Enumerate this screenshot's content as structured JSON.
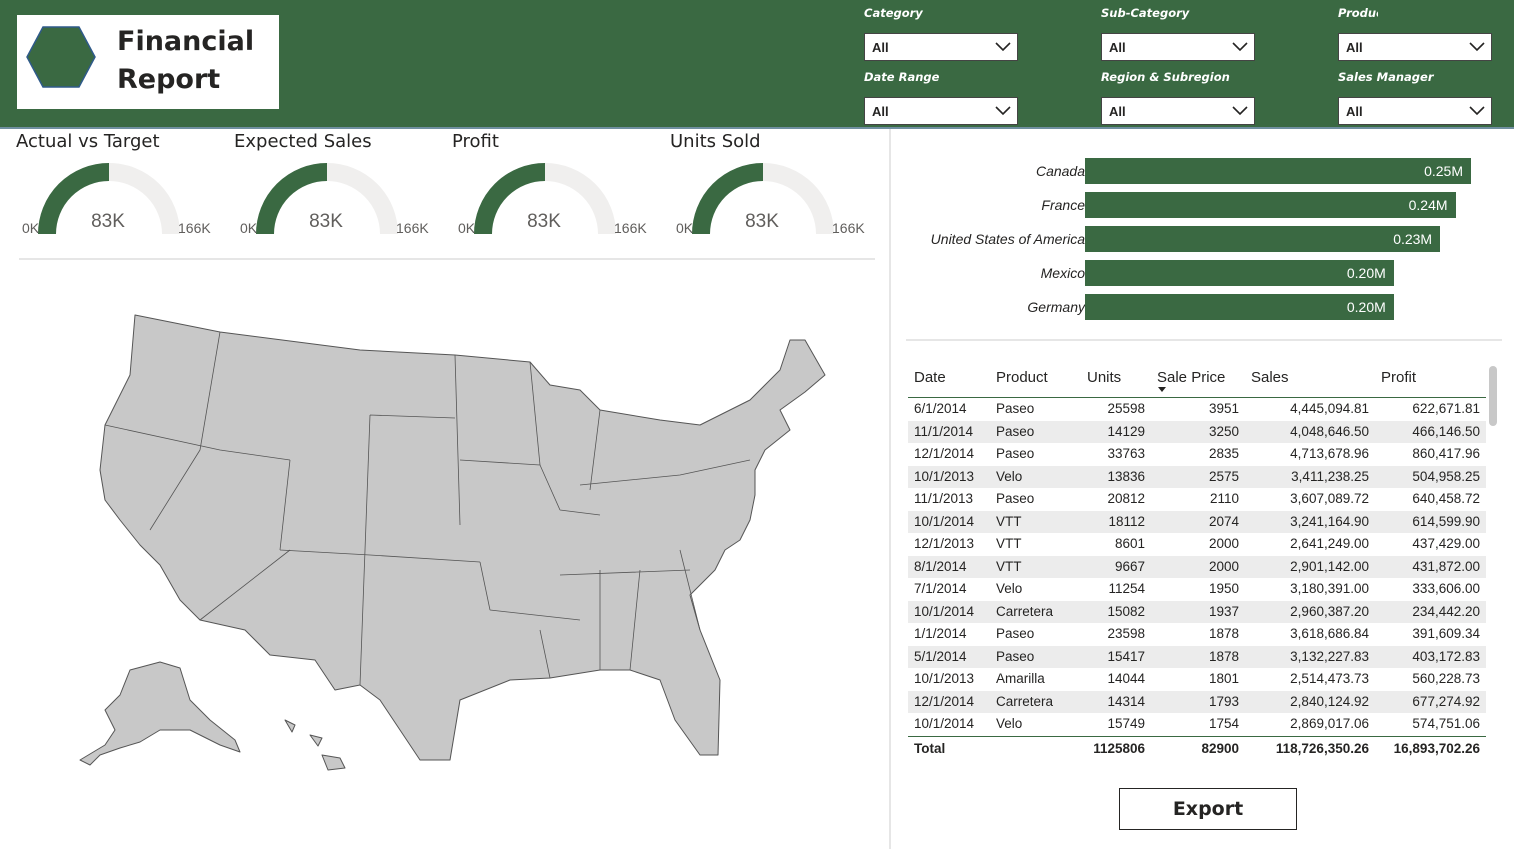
{
  "header": {
    "title": "Financial Report",
    "logo_icon": "hexagon-icon"
  },
  "slicers": [
    {
      "label": "Category",
      "value": "All"
    },
    {
      "label": "Sub-Category",
      "value": "All"
    },
    {
      "label": "Product",
      "value": "All"
    },
    {
      "label": "Date Range",
      "value": "All"
    },
    {
      "label": "Region & Subregion",
      "value": "All"
    },
    {
      "label": "Sales Manager",
      "value": "All"
    }
  ],
  "gauges": [
    {
      "title": "Actual vs Target",
      "min": "0K",
      "value_label": "83K",
      "max": "166K",
      "value": 83,
      "max_value": 166
    },
    {
      "title": "Expected Sales",
      "min": "0K",
      "value_label": "83K",
      "max": "166K",
      "value": 83,
      "max_value": 166
    },
    {
      "title": "Profit",
      "min": "0K",
      "value_label": "83K",
      "max": "166K",
      "value": 83,
      "max_value": 166
    },
    {
      "title": "Units Sold",
      "min": "0K",
      "value_label": "83K",
      "max": "166K",
      "value": 83,
      "max_value": 166
    }
  ],
  "chart_data": {
    "type": "bar",
    "orientation": "horizontal",
    "categories": [
      "Canada",
      "France",
      "United States of America",
      "Mexico",
      "Germany"
    ],
    "values": [
      0.25,
      0.24,
      0.23,
      0.2,
      0.2
    ],
    "value_labels": [
      "0.25M",
      "0.24M",
      "0.23M",
      "0.20M",
      "0.20M"
    ],
    "unit": "M"
  },
  "table": {
    "columns": [
      "Date",
      "Product",
      "Units",
      "Sale Price",
      "Sales",
      "Profit"
    ],
    "rows": [
      [
        "6/1/2014",
        "Paseo",
        "25598",
        "3951",
        "4,445,094.81",
        "622,671.81"
      ],
      [
        "11/1/2014",
        "Paseo",
        "14129",
        "3250",
        "4,048,646.50",
        "466,146.50"
      ],
      [
        "12/1/2014",
        "Paseo",
        "33763",
        "2835",
        "4,713,678.96",
        "860,417.96"
      ],
      [
        "10/1/2013",
        "Velo",
        "13836",
        "2575",
        "3,411,238.25",
        "504,958.25"
      ],
      [
        "11/1/2013",
        "Paseo",
        "20812",
        "2110",
        "3,607,089.72",
        "640,458.72"
      ],
      [
        "10/1/2014",
        "VTT",
        "18112",
        "2074",
        "3,241,164.90",
        "614,599.90"
      ],
      [
        "12/1/2013",
        "VTT",
        "8601",
        "2000",
        "2,641,249.00",
        "437,429.00"
      ],
      [
        "8/1/2014",
        "VTT",
        "9667",
        "2000",
        "2,901,142.00",
        "431,872.00"
      ],
      [
        "7/1/2014",
        "Velo",
        "11254",
        "1950",
        "3,180,391.00",
        "333,606.00"
      ],
      [
        "10/1/2014",
        "Carretera",
        "15082",
        "1937",
        "2,960,387.20",
        "234,442.20"
      ],
      [
        "1/1/2014",
        "Paseo",
        "23598",
        "1878",
        "3,618,686.84",
        "391,609.34"
      ],
      [
        "5/1/2014",
        "Paseo",
        "15417",
        "1878",
        "3,132,227.83",
        "403,172.83"
      ],
      [
        "10/1/2013",
        "Amarilla",
        "14044",
        "1801",
        "2,514,473.73",
        "560,228.73"
      ],
      [
        "12/1/2014",
        "Carretera",
        "14314",
        "1793",
        "2,840,124.92",
        "677,274.92"
      ],
      [
        "10/1/2014",
        "Velo",
        "15749",
        "1754",
        "2,869,017.06",
        "574,751.06"
      ]
    ],
    "total": [
      "Total",
      "",
      "1125806",
      "82900",
      "118,726,350.26",
      "16,893,702.26"
    ]
  },
  "export_label": "Export",
  "colors": {
    "accent": "#3a6942",
    "gauge_track": "#f0efee",
    "map_fill": "#c8c8c8"
  }
}
